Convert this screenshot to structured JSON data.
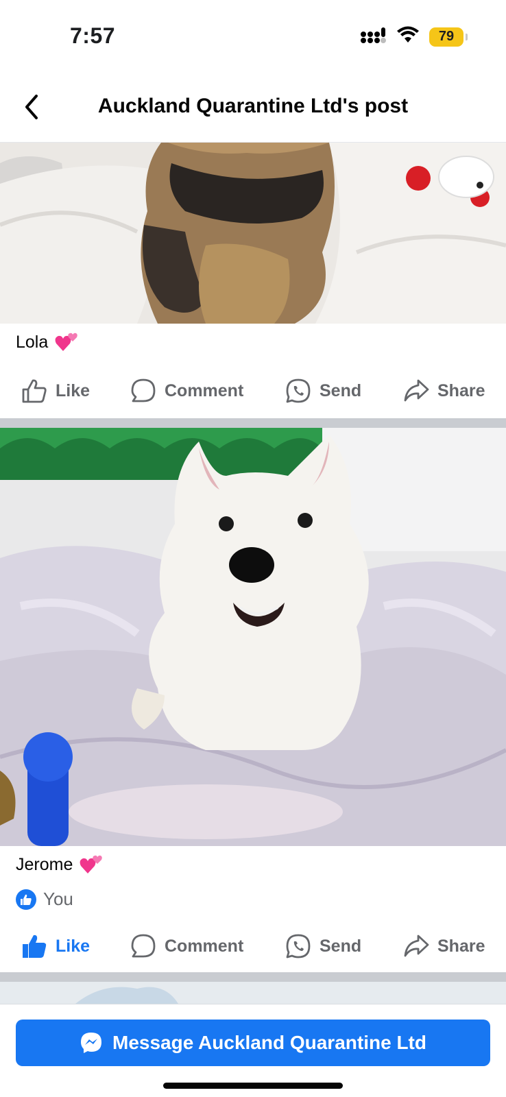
{
  "status_bar": {
    "time": "7:57",
    "battery": "79"
  },
  "header": {
    "title": "Auckland Quarantine Ltd's post"
  },
  "posts": [
    {
      "caption": "Lola",
      "actions": {
        "like": "Like",
        "comment": "Comment",
        "send": "Send",
        "share": "Share"
      },
      "liked": false
    },
    {
      "caption": "Jerome",
      "reaction_text": "You",
      "actions": {
        "like": "Like",
        "comment": "Comment",
        "send": "Send",
        "share": "Share"
      },
      "liked": true
    }
  ],
  "bottom": {
    "message_button": "Message Auckland Quarantine Ltd"
  },
  "colors": {
    "brand_blue": "#1877f2",
    "battery_yellow": "#f5c518",
    "grey_text": "#65676b"
  },
  "icons": [
    "back-arrow-icon",
    "signal-icon",
    "wifi-icon",
    "battery-icon",
    "two-hearts-emoji",
    "thumbs-up-icon",
    "comment-icon",
    "whatsapp-send-icon",
    "share-arrow-icon",
    "messenger-icon"
  ]
}
